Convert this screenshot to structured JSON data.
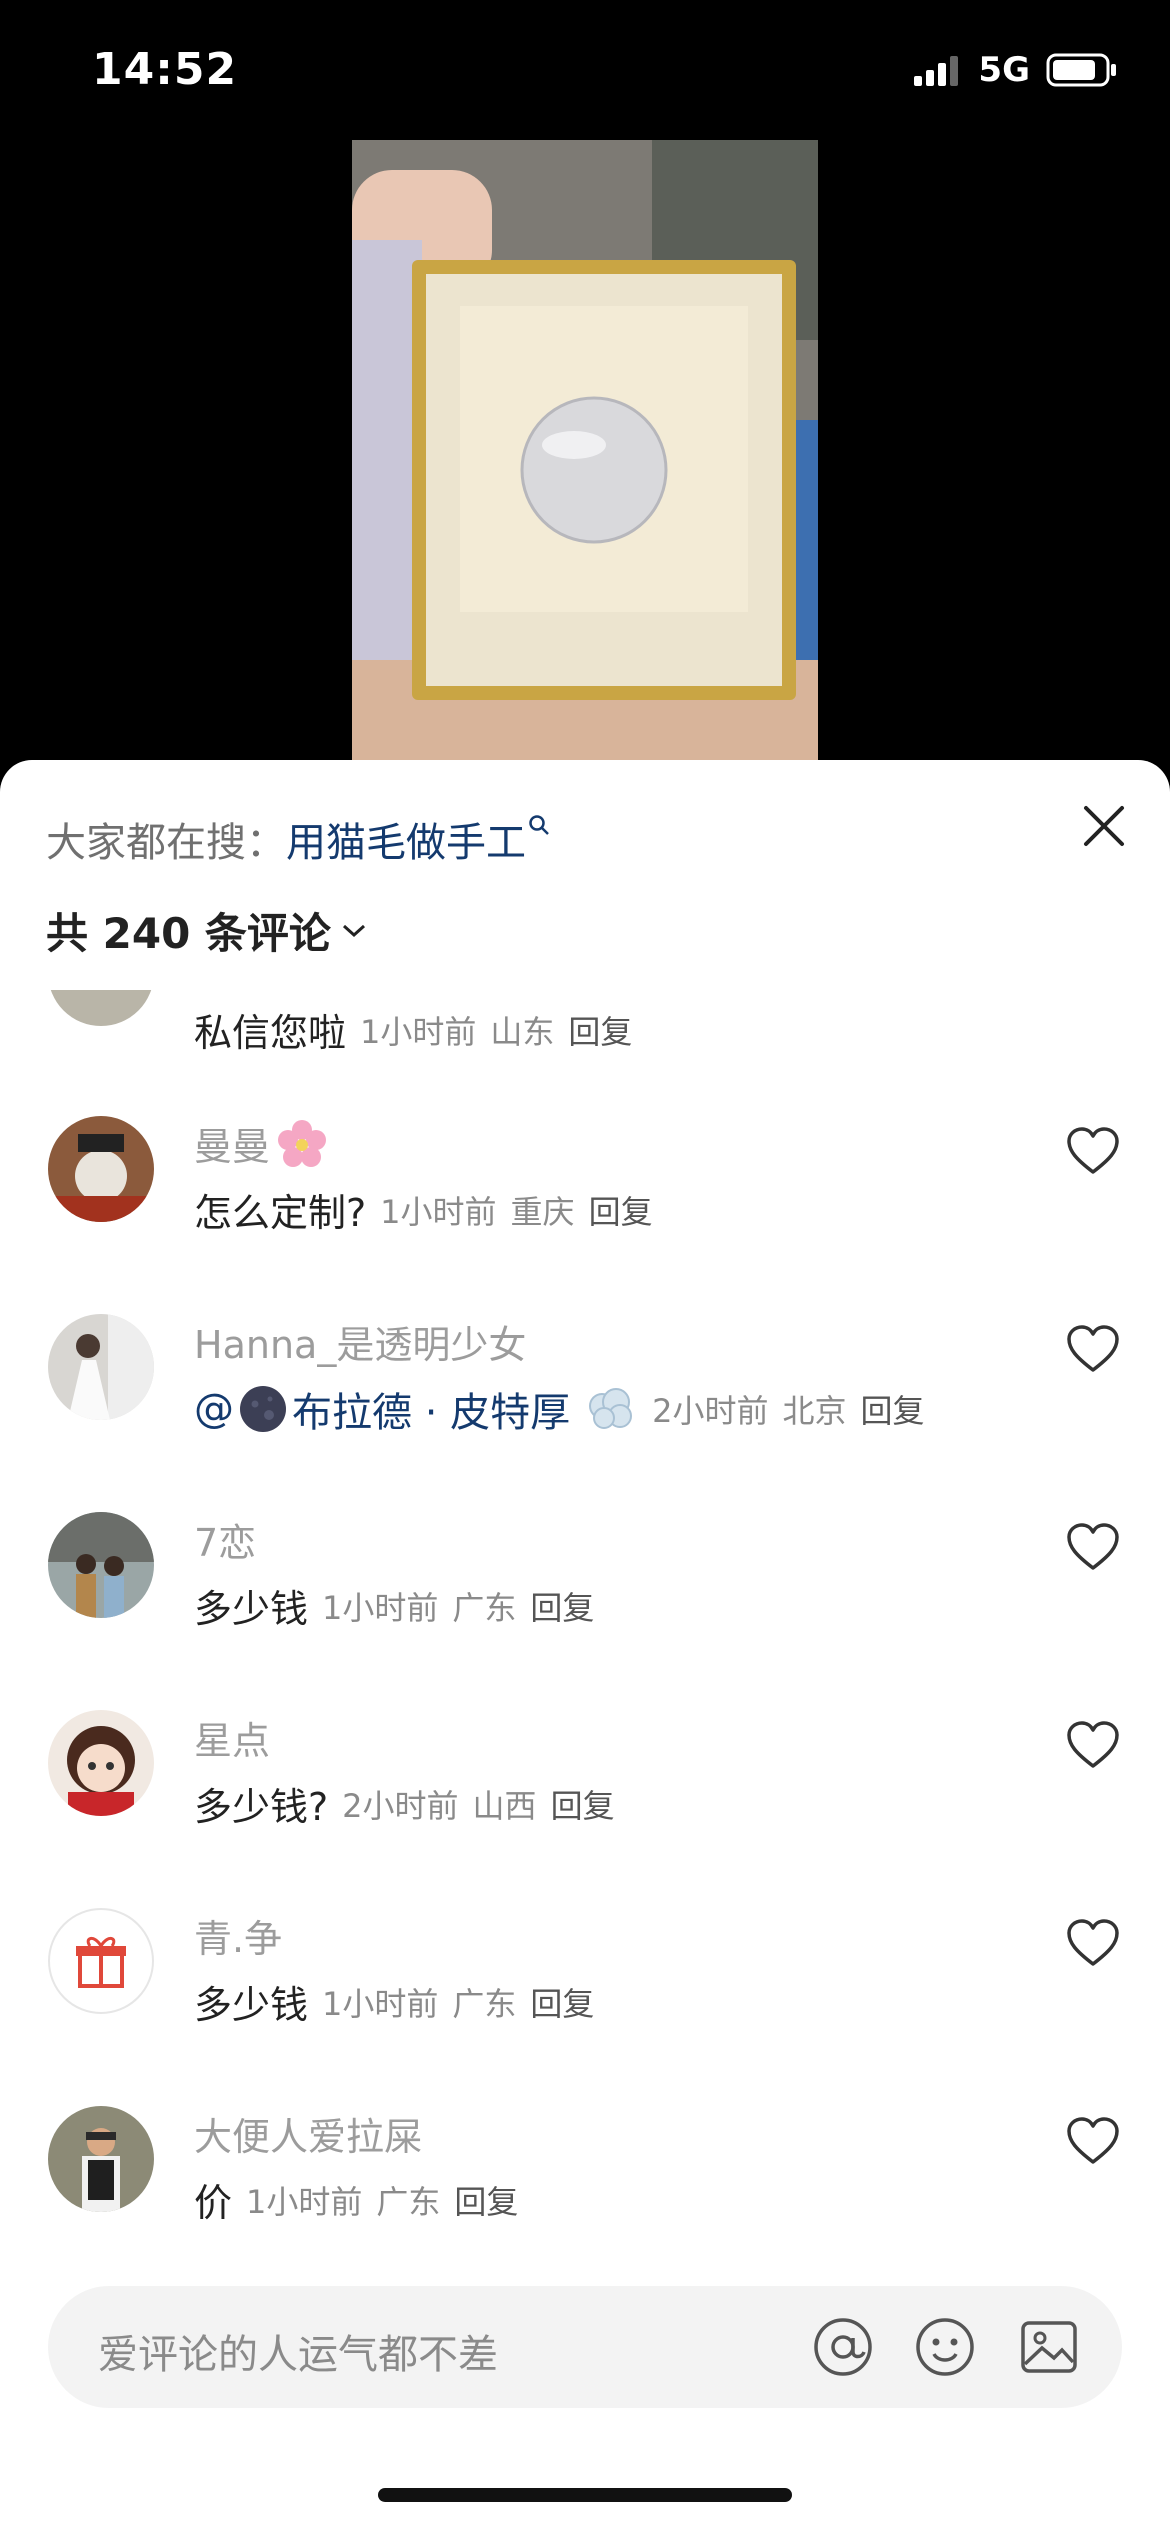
{
  "status": {
    "time": "14:52",
    "network": "5G"
  },
  "sheet": {
    "search_prefix": "大家都在搜：",
    "search_term": "用猫毛做手工",
    "comment_count_label": "共 240 条评论"
  },
  "comments": [
    {
      "username": "",
      "text": "私信您啦",
      "time": "1小时前",
      "location": "山东",
      "reply": "回复"
    },
    {
      "username": "曼曼",
      "text": "怎么定制?",
      "time": "1小时前",
      "location": "重庆",
      "reply": "回复"
    },
    {
      "username": "Hanna_是透明少女",
      "text": "@",
      "mention": "布拉德 · 皮特厚",
      "time": "2小时前",
      "location": "北京",
      "reply": "回复"
    },
    {
      "username": "7恋",
      "text": "多少钱",
      "time": "1小时前",
      "location": "广东",
      "reply": "回复"
    },
    {
      "username": "星点",
      "text": "多少钱?",
      "time": "2小时前",
      "location": "山西",
      "reply": "回复"
    },
    {
      "username": "青.争",
      "text": "多少钱",
      "time": "1小时前",
      "location": "广东",
      "reply": "回复"
    },
    {
      "username": "大便人爱拉屎",
      "text": "价",
      "time": "1小时前",
      "location": "广东",
      "reply": "回复"
    }
  ],
  "input": {
    "placeholder": "爱评论的人运气都不差"
  },
  "icons": {
    "close": "close-icon",
    "heart": "heart-outline-icon",
    "at": "at-icon",
    "emoji": "emoji-icon",
    "image": "image-icon",
    "search": "search-icon",
    "chevron": "chevron-down-icon"
  }
}
